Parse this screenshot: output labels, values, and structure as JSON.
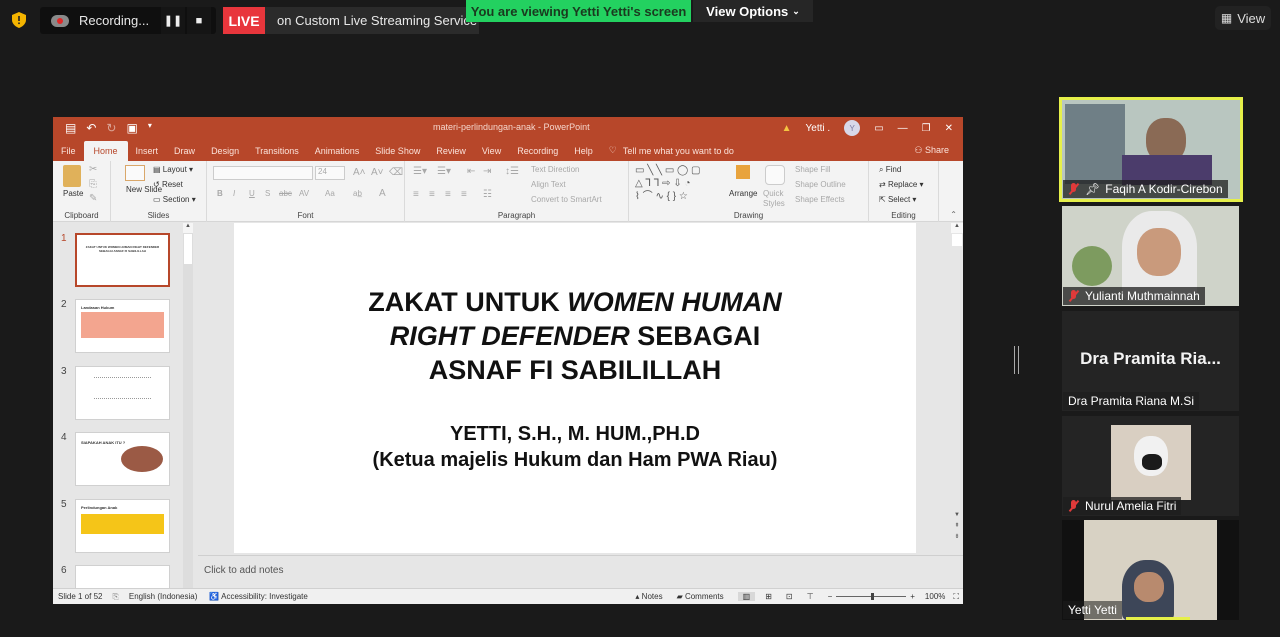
{
  "zoom_bar": {
    "recording_label": "Recording...",
    "live_label": "LIVE",
    "live_text": "on Custom Live Streaming Service",
    "viewing_banner": "You are viewing Yetti Yetti's screen",
    "view_options": "View Options",
    "view_button": "View",
    "colors": {
      "live": "#e8363c",
      "banner": "#23d160",
      "active_speaker": "#e6f04a"
    }
  },
  "ppt": {
    "window_title": "materi-perlindungan-anak - PowerPoint",
    "user": "Yetti .",
    "user_initial": "Y",
    "tabs": [
      "File",
      "Home",
      "Insert",
      "Draw",
      "Design",
      "Transitions",
      "Animations",
      "Slide Show",
      "Review",
      "View",
      "Recording",
      "Help"
    ],
    "active_tab": "Home",
    "tell_me": "Tell me what you want to do",
    "share": "Share",
    "ribbon": {
      "clipboard": {
        "label": "Clipboard",
        "paste": "Paste"
      },
      "slides": {
        "label": "Slides",
        "new_slide": "New Slide",
        "layout": "Layout",
        "reset": "Reset",
        "section": "Section"
      },
      "font": {
        "label": "Font",
        "size": "24",
        "buttons": [
          "B",
          "I",
          "U",
          "S",
          "abc",
          "AV",
          "Aa",
          "A"
        ]
      },
      "paragraph": {
        "label": "Paragraph",
        "text_direction": "Text Direction",
        "align_text": "Align Text",
        "convert_smartart": "Convert to SmartArt"
      },
      "drawing": {
        "label": "Drawing",
        "arrange": "Arrange",
        "quick_styles": "Quick Styles",
        "shape_fill": "Shape Fill",
        "shape_outline": "Shape Outline",
        "shape_effects": "Shape Effects"
      },
      "editing": {
        "label": "Editing",
        "find": "Find",
        "replace": "Replace",
        "select": "Select"
      }
    },
    "thumbnails": [
      {
        "num": "1",
        "title": "ZAKAT UNTUK WOMEN HUMAN RIGHT DEFENDER SEBAGAI ASNAF FI SABILILLAH"
      },
      {
        "num": "2",
        "title": "Landasan Hukum"
      },
      {
        "num": "3",
        "title": ""
      },
      {
        "num": "4",
        "title": "SIAPAKAH ANAK ITU ?"
      },
      {
        "num": "5",
        "title": "Perlindungan Anak"
      },
      {
        "num": "6",
        "title": ""
      }
    ],
    "slide": {
      "title_parts": [
        {
          "text": "ZAKAT UNTUK ",
          "italic": false
        },
        {
          "text": "WOMEN HUMAN",
          "italic": true
        }
      ],
      "title_line2": [
        {
          "text": "RIGHT DEFENDER",
          "italic": true
        },
        {
          "text": " SEBAGAI",
          "italic": false
        }
      ],
      "title_line3": "ASNAF FI SABILILLAH",
      "author": "YETTI, S.H., M. HUM.,PH.D",
      "affiliation": "(Ketua majelis Hukum dan Ham PWA Riau)"
    },
    "notes_placeholder": "Click to add notes",
    "status": {
      "slide_count": "Slide 1 of 52",
      "language": "English (Indonesia)",
      "accessibility": "Accessibility: Investigate",
      "notes": "Notes",
      "comments": "Comments",
      "zoom": "100%",
      "zoom_level_percent": 100
    }
  },
  "participants": [
    {
      "name": "Faqih A Kodir-Cirebon",
      "muted": true,
      "pinned": true,
      "active": true
    },
    {
      "name": "Yulianti Muthmainnah",
      "muted": true
    },
    {
      "name": "Dra Pramita Riana M.Si",
      "display": "Dra Pramita Ria...",
      "muted": false,
      "video": false
    },
    {
      "name": "Nurul Amelia Fitri",
      "muted": true
    },
    {
      "name": "Yetti Yetti",
      "muted": false
    }
  ]
}
